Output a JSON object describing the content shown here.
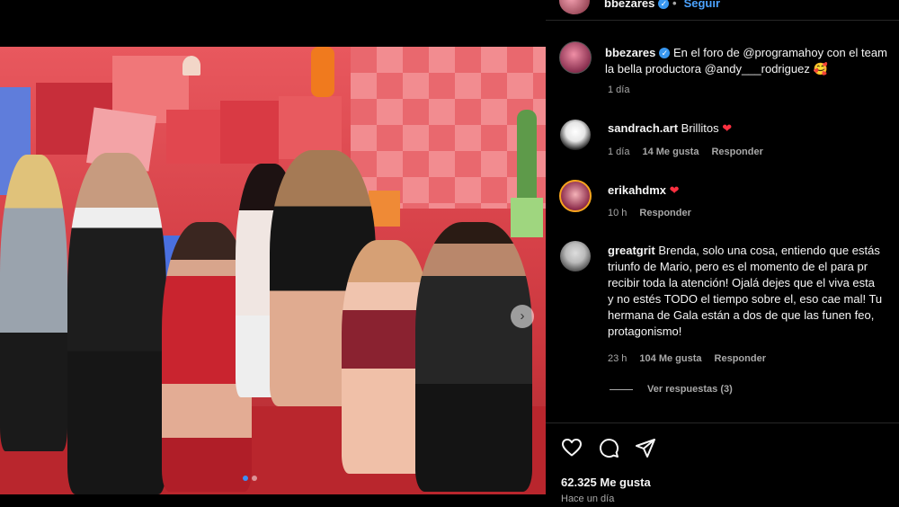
{
  "header": {
    "username": "bbezares",
    "follow_label": "Seguir"
  },
  "caption": {
    "username": "bbezares",
    "line1": "En el foro de @programahoy con el team",
    "line2": "la bella productora @andy___rodriguez 🥰",
    "time": "1 día"
  },
  "comments": [
    {
      "username": "sandrach.art",
      "text": "Brillitos",
      "time": "1 día",
      "likes": "14 Me gusta",
      "reply": "Responder"
    },
    {
      "username": "erikahdmx",
      "text": "",
      "time": "10 h",
      "likes": "",
      "reply": "Responder"
    },
    {
      "username": "greatgrit",
      "lines": [
        "Brenda, solo una cosa, entiendo que estás",
        "triunfo de Mario, pero es el momento de el para pr",
        "recibir toda la atención! Ojalá dejes que el viva esta",
        "y no estés TODO el tiempo sobre el, eso cae mal! Tu",
        "hermana de Gala están a dos de que las funen feo,",
        "protagonismo!"
      ],
      "time": "23 h",
      "likes": "104 Me gusta",
      "reply": "Responder",
      "view_replies": "Ver respuestas (3)"
    }
  ],
  "footer": {
    "likes": "62.325 Me gusta",
    "posted": "Hace un día"
  },
  "icons": {
    "verified": "✓",
    "heart": "❤",
    "next": "›"
  },
  "colors": {
    "background": "#000000",
    "link": "#4ca3ff",
    "verified": "#3897f0",
    "heart": "#ff3040",
    "story_ring": "#f7a51e"
  }
}
